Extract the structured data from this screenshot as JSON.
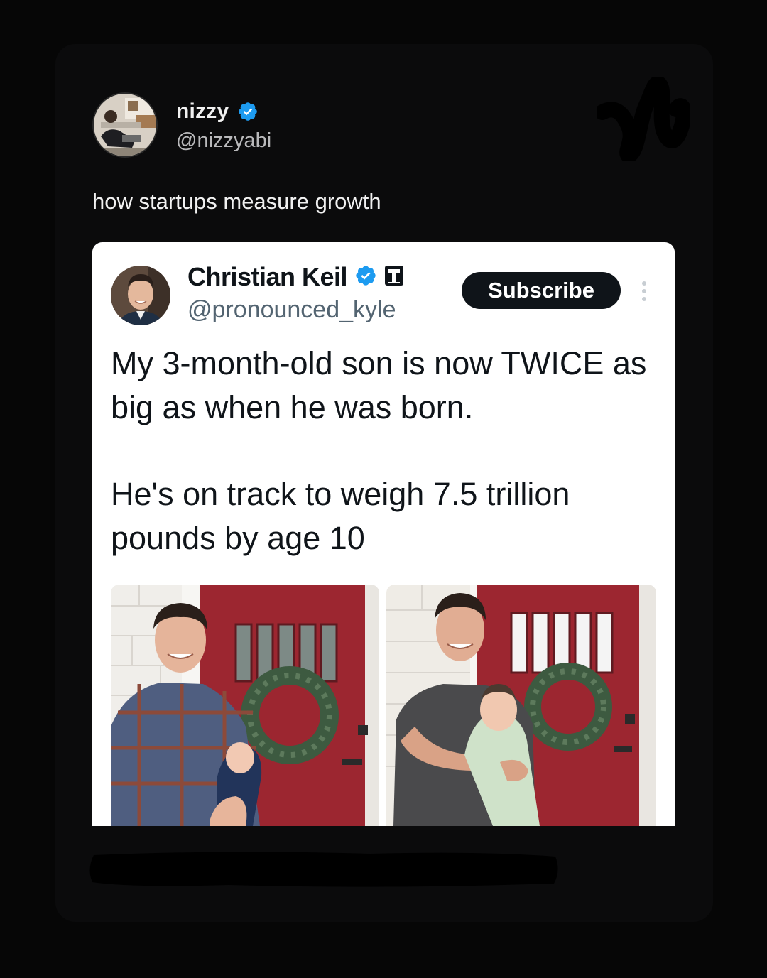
{
  "post": {
    "author": {
      "display_name": "nizzy",
      "handle": "@nizzyabi",
      "verified": true
    },
    "text": "how startups measure growth"
  },
  "embedded_post": {
    "author": {
      "display_name": "Christian Keil",
      "handle": "@pronounced_kyle",
      "verified": true,
      "affiliate_badge": true
    },
    "subscribe_label": "Subscribe",
    "text_paragraphs": [
      "My 3-month-old son is now TWICE as big as when he was born.",
      "He's on track to weigh 7.5 trillion pounds by age 10"
    ]
  },
  "colors": {
    "page_bg": "#060606",
    "card_bg": "#0b0b0c",
    "verified_blue": "#1d9bf0",
    "door_red": "#9c2630",
    "subscribe_bg": "#0f1419"
  },
  "icons": {
    "verified": "verified-badge-icon",
    "more": "more-vertical-icon",
    "affiliate": "affiliate-badge-icon"
  }
}
